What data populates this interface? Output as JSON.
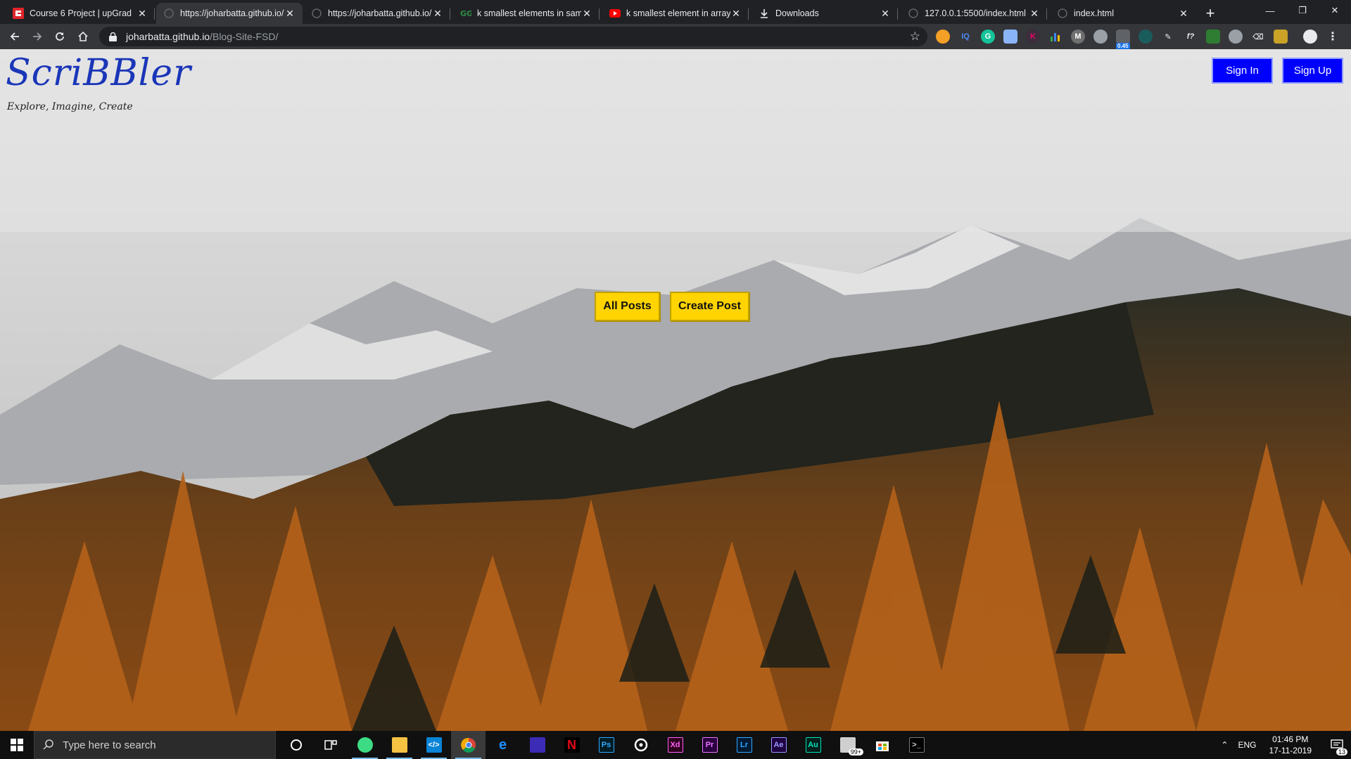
{
  "browser": {
    "tabs": [
      {
        "title": "Course 6 Project | upGrad",
        "favicon": "upgrad-icon",
        "active": false
      },
      {
        "title": "https://joharbatta.github.io/",
        "favicon": "globe-icon",
        "active": true
      },
      {
        "title": "https://joharbatta.github.io/",
        "favicon": "globe-icon",
        "active": false
      },
      {
        "title": "k smallest elements in same",
        "favicon": "gfg-icon",
        "active": false
      },
      {
        "title": "k smallest element in array",
        "favicon": "youtube-icon",
        "active": false
      },
      {
        "title": "Downloads",
        "favicon": "download-icon",
        "active": false
      },
      {
        "title": "127.0.0.1:5500/index.html",
        "favicon": "globe-icon",
        "active": false
      },
      {
        "title": "index.html",
        "favicon": "globe-icon",
        "active": false
      }
    ],
    "new_tab": "+",
    "window_controls": {
      "minimize": "—",
      "maximize": "❐",
      "close": "✕"
    },
    "address": {
      "host": "joharbatta.github.io",
      "path": "/Blog-Site-FSD/"
    },
    "extension_badge": "0.45"
  },
  "page": {
    "logo": "ScriBBler",
    "tagline": "Explore, Imagine, Create",
    "sign_in": "Sign In",
    "sign_up": "Sign Up",
    "all_posts": "All Posts",
    "create_post": "Create Post",
    "colors": {
      "auth_button": "#0000ff",
      "cta_button": "#ffd400",
      "logo": "#1a36b8"
    }
  },
  "taskbar": {
    "search_placeholder": "Type here to search",
    "apps": [
      "cortana-icon",
      "task-view-icon",
      "android-studio-icon",
      "file-explorer-icon",
      "vscode-icon",
      "chrome-icon",
      "edge-icon",
      "amazon-music-icon",
      "netflix-icon",
      "photoshop-icon",
      "groove-icon",
      "xd-icon",
      "premiere-icon",
      "lightroom-icon",
      "after-effects-icon",
      "audition-icon",
      "mail-icon",
      "store-icon",
      "terminal-icon"
    ],
    "mail_badge": "99+",
    "language": "ENG",
    "time": "01:46 PM",
    "date": "17-11-2019",
    "notifications": "13"
  }
}
